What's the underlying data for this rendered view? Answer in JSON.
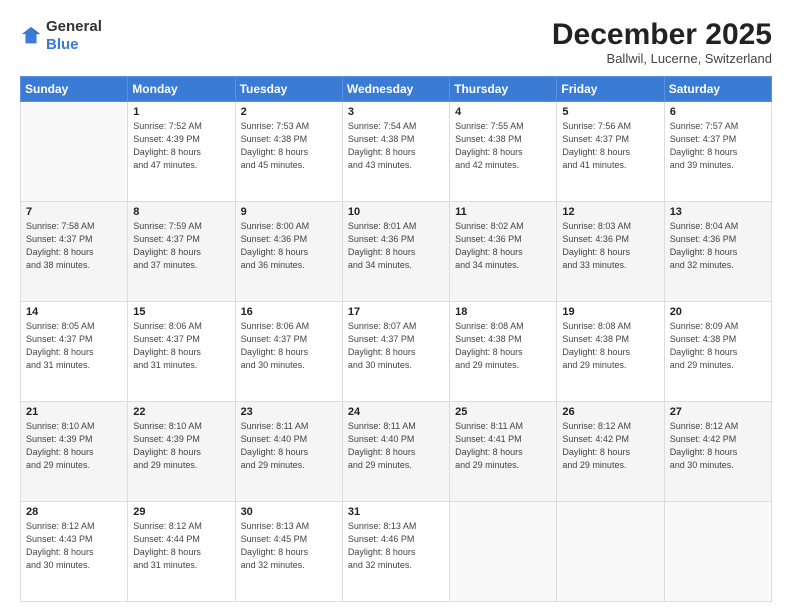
{
  "logo": {
    "general": "General",
    "blue": "Blue"
  },
  "header": {
    "month": "December 2025",
    "location": "Ballwil, Lucerne, Switzerland"
  },
  "weekdays": [
    "Sunday",
    "Monday",
    "Tuesday",
    "Wednesday",
    "Thursday",
    "Friday",
    "Saturday"
  ],
  "weeks": [
    [
      {
        "day": "",
        "info": ""
      },
      {
        "day": "1",
        "info": "Sunrise: 7:52 AM\nSunset: 4:39 PM\nDaylight: 8 hours\nand 47 minutes."
      },
      {
        "day": "2",
        "info": "Sunrise: 7:53 AM\nSunset: 4:38 PM\nDaylight: 8 hours\nand 45 minutes."
      },
      {
        "day": "3",
        "info": "Sunrise: 7:54 AM\nSunset: 4:38 PM\nDaylight: 8 hours\nand 43 minutes."
      },
      {
        "day": "4",
        "info": "Sunrise: 7:55 AM\nSunset: 4:38 PM\nDaylight: 8 hours\nand 42 minutes."
      },
      {
        "day": "5",
        "info": "Sunrise: 7:56 AM\nSunset: 4:37 PM\nDaylight: 8 hours\nand 41 minutes."
      },
      {
        "day": "6",
        "info": "Sunrise: 7:57 AM\nSunset: 4:37 PM\nDaylight: 8 hours\nand 39 minutes."
      }
    ],
    [
      {
        "day": "7",
        "info": "Sunrise: 7:58 AM\nSunset: 4:37 PM\nDaylight: 8 hours\nand 38 minutes."
      },
      {
        "day": "8",
        "info": "Sunrise: 7:59 AM\nSunset: 4:37 PM\nDaylight: 8 hours\nand 37 minutes."
      },
      {
        "day": "9",
        "info": "Sunrise: 8:00 AM\nSunset: 4:36 PM\nDaylight: 8 hours\nand 36 minutes."
      },
      {
        "day": "10",
        "info": "Sunrise: 8:01 AM\nSunset: 4:36 PM\nDaylight: 8 hours\nand 34 minutes."
      },
      {
        "day": "11",
        "info": "Sunrise: 8:02 AM\nSunset: 4:36 PM\nDaylight: 8 hours\nand 34 minutes."
      },
      {
        "day": "12",
        "info": "Sunrise: 8:03 AM\nSunset: 4:36 PM\nDaylight: 8 hours\nand 33 minutes."
      },
      {
        "day": "13",
        "info": "Sunrise: 8:04 AM\nSunset: 4:36 PM\nDaylight: 8 hours\nand 32 minutes."
      }
    ],
    [
      {
        "day": "14",
        "info": "Sunrise: 8:05 AM\nSunset: 4:37 PM\nDaylight: 8 hours\nand 31 minutes."
      },
      {
        "day": "15",
        "info": "Sunrise: 8:06 AM\nSunset: 4:37 PM\nDaylight: 8 hours\nand 31 minutes."
      },
      {
        "day": "16",
        "info": "Sunrise: 8:06 AM\nSunset: 4:37 PM\nDaylight: 8 hours\nand 30 minutes."
      },
      {
        "day": "17",
        "info": "Sunrise: 8:07 AM\nSunset: 4:37 PM\nDaylight: 8 hours\nand 30 minutes."
      },
      {
        "day": "18",
        "info": "Sunrise: 8:08 AM\nSunset: 4:38 PM\nDaylight: 8 hours\nand 29 minutes."
      },
      {
        "day": "19",
        "info": "Sunrise: 8:08 AM\nSunset: 4:38 PM\nDaylight: 8 hours\nand 29 minutes."
      },
      {
        "day": "20",
        "info": "Sunrise: 8:09 AM\nSunset: 4:38 PM\nDaylight: 8 hours\nand 29 minutes."
      }
    ],
    [
      {
        "day": "21",
        "info": "Sunrise: 8:10 AM\nSunset: 4:39 PM\nDaylight: 8 hours\nand 29 minutes."
      },
      {
        "day": "22",
        "info": "Sunrise: 8:10 AM\nSunset: 4:39 PM\nDaylight: 8 hours\nand 29 minutes."
      },
      {
        "day": "23",
        "info": "Sunrise: 8:11 AM\nSunset: 4:40 PM\nDaylight: 8 hours\nand 29 minutes."
      },
      {
        "day": "24",
        "info": "Sunrise: 8:11 AM\nSunset: 4:40 PM\nDaylight: 8 hours\nand 29 minutes."
      },
      {
        "day": "25",
        "info": "Sunrise: 8:11 AM\nSunset: 4:41 PM\nDaylight: 8 hours\nand 29 minutes."
      },
      {
        "day": "26",
        "info": "Sunrise: 8:12 AM\nSunset: 4:42 PM\nDaylight: 8 hours\nand 29 minutes."
      },
      {
        "day": "27",
        "info": "Sunrise: 8:12 AM\nSunset: 4:42 PM\nDaylight: 8 hours\nand 30 minutes."
      }
    ],
    [
      {
        "day": "28",
        "info": "Sunrise: 8:12 AM\nSunset: 4:43 PM\nDaylight: 8 hours\nand 30 minutes."
      },
      {
        "day": "29",
        "info": "Sunrise: 8:12 AM\nSunset: 4:44 PM\nDaylight: 8 hours\nand 31 minutes."
      },
      {
        "day": "30",
        "info": "Sunrise: 8:13 AM\nSunset: 4:45 PM\nDaylight: 8 hours\nand 32 minutes."
      },
      {
        "day": "31",
        "info": "Sunrise: 8:13 AM\nSunset: 4:46 PM\nDaylight: 8 hours\nand 32 minutes."
      },
      {
        "day": "",
        "info": ""
      },
      {
        "day": "",
        "info": ""
      },
      {
        "day": "",
        "info": ""
      }
    ]
  ]
}
